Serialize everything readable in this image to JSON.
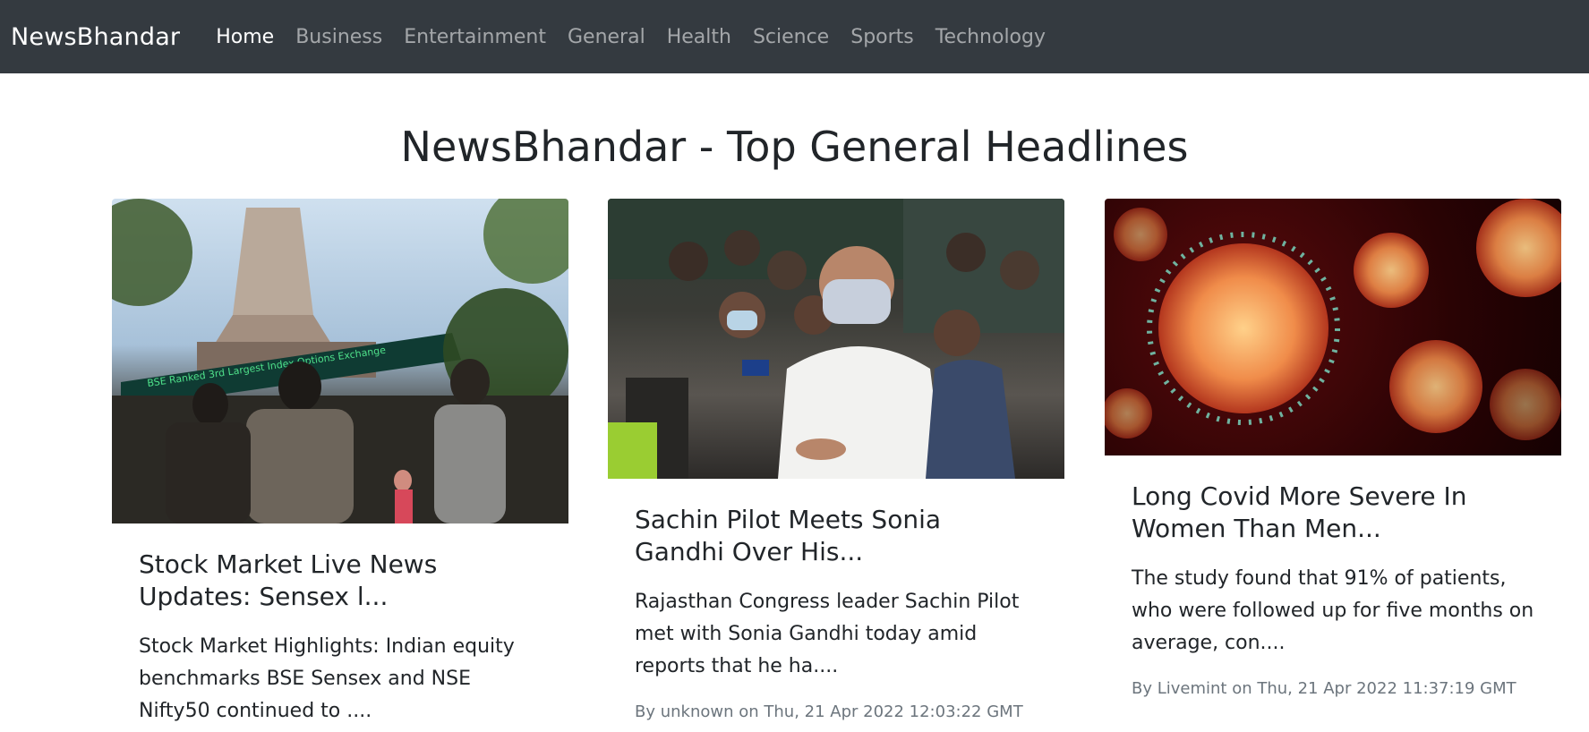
{
  "brand": "NewsBhandar",
  "nav": [
    {
      "label": "Home",
      "active": true
    },
    {
      "label": "Business",
      "active": false
    },
    {
      "label": "Entertainment",
      "active": false
    },
    {
      "label": "General",
      "active": false
    },
    {
      "label": "Health",
      "active": false
    },
    {
      "label": "Science",
      "active": false
    },
    {
      "label": "Sports",
      "active": false
    },
    {
      "label": "Technology",
      "active": false
    }
  ],
  "page_heading": "NewsBhandar - Top General Headlines",
  "cards": [
    {
      "title": "Stock Market Live News Updates: Sensex l...",
      "description": "Stock Market Highlights: Indian equity benchmarks BSE Sensex and NSE Nifty50 continued to ....",
      "meta": "",
      "image_banner": "BSE Ranked 3rd Largest Index Options Exchange"
    },
    {
      "title": "Sachin Pilot Meets Sonia Gandhi Over His...",
      "description": "Rajasthan Congress leader Sachin Pilot met with Sonia Gandhi today amid reports that he ha....",
      "meta": "By unknown on Thu, 21 Apr 2022 12:03:22 GMT"
    },
    {
      "title": "Long Covid More Severe In Women Than Men...",
      "description": "The study found that 91% of patients, who were followed up for five months on average, con....",
      "meta": "By Livemint on Thu, 21 Apr 2022 11:37:19 GMT"
    }
  ],
  "colors": {
    "navbar_bg": "#343a40",
    "muted_text": "#6c757d"
  }
}
